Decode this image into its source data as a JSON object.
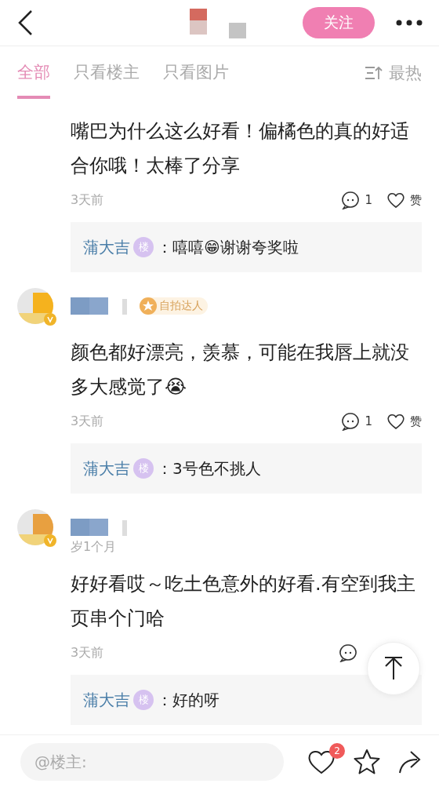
{
  "header": {
    "follow_label": "关注"
  },
  "tabs": [
    {
      "label": "全部",
      "selected": true
    },
    {
      "label": "只看楼主",
      "selected": false
    },
    {
      "label": "只看图片",
      "selected": false
    }
  ],
  "sort_label": "最热",
  "comments": [
    {
      "kind": "cont",
      "text": "嘴巴为什么这么好看！偏橘色的真的好适合你哦！太棒了分享",
      "time": "3天前",
      "comment_count": "1",
      "like_label": "赞",
      "reply": {
        "author": "蒲大吉",
        "author_badge": "楼",
        "text": "：嘻嘻😁谢谢夸奖啦"
      }
    },
    {
      "kind": "full",
      "badge": "自拍达人",
      "text": "颜色都好漂亮，羡慕，可能在我唇上就没多大感觉了😭",
      "time": "3天前",
      "comment_count": "1",
      "like_label": "赞",
      "reply": {
        "author": "蒲大吉",
        "author_badge": "楼",
        "text": "：3号色不挑人"
      }
    },
    {
      "kind": "full",
      "meta": "岁1个月",
      "text": "好好看哎～吃土色意外的好看.有空到我主页串个门哈",
      "time": "3天前",
      "reply": {
        "author": "蒲大吉",
        "author_badge": "楼",
        "text": "：好的呀"
      }
    }
  ],
  "input": {
    "placeholder": "@楼主:"
  },
  "like_badge": "2"
}
